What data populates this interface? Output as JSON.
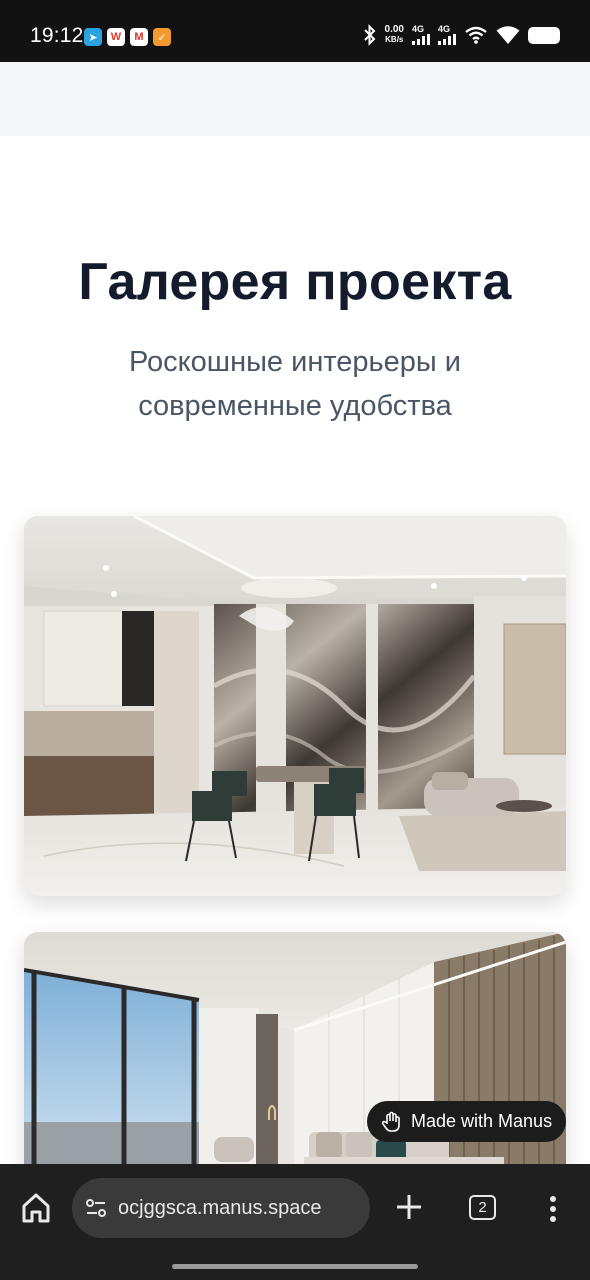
{
  "status_bar": {
    "time": "19:12",
    "notifications": [
      {
        "name": "telegram-icon",
        "glyph": "➤",
        "color": "#2aa3e0"
      },
      {
        "name": "wps-icon",
        "glyph": "W",
        "color": "#e23b2e"
      },
      {
        "name": "gmail-icon",
        "glyph": "M",
        "color": "#ffffff"
      },
      {
        "name": "app-icon",
        "glyph": "✓",
        "color": "#f29a2e"
      }
    ],
    "net_speed_value": "0.00",
    "net_speed_unit": "KB/s",
    "sim1_label": "4G",
    "sim2_label": "4G"
  },
  "hero": {
    "title": "Галерея проекта",
    "subtitle": "Роскошные интерьеры и современные удобства"
  },
  "gallery": {
    "images": [
      {
        "name": "living-dining-room-image",
        "description": "interior photo"
      },
      {
        "name": "bedroom-image",
        "description": "interior photo"
      }
    ]
  },
  "badge": {
    "label": "Made with Manus"
  },
  "browser": {
    "url": "ocjggsca.manus.space",
    "tab_count": "2"
  },
  "colors": {
    "title": "#141b2d",
    "subtitle": "#4a5566",
    "browser_bar": "#1f1f1f",
    "url_pill": "#3a3a3a"
  }
}
